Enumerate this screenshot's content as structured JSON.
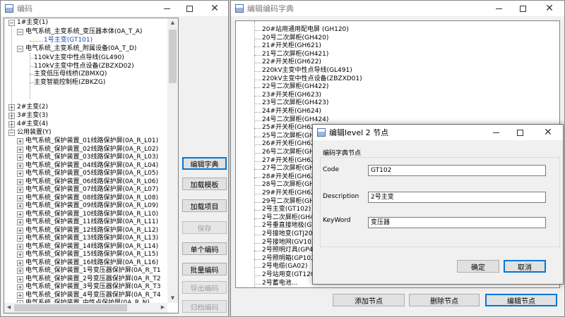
{
  "left_window": {
    "title": "编码",
    "tree": {
      "root1": "1#主变(1)",
      "child1": "电气系统_主变系统_变压器本体(0A_T_A)",
      "leaf1": "1号主变(GT101)",
      "child2": "电气系统_主变系统_附属设备(0A_T_D)",
      "sub_items": [
        "110kV主变中性点导线(GL490)",
        "110kV主变中性点设备(ZBZXD02)",
        "主变低压母线桥(ZBMXQ)",
        "主变智能控制柜(ZBKZG)"
      ],
      "roots": [
        "2#主变(2)",
        "3#主变(3)",
        "4#主变(4)"
      ],
      "public": "公用装置(Y)",
      "public_items": [
        "电气系统_保护装置_01线路保护屏(0A_R_L01)",
        "电气系统_保护装置_02线路保护屏(0A_R_L02)",
        "电气系统_保护装置_03线路保护屏(0A_R_L03)",
        "电气系统_保护装置_04线路保护屏(0A_R_L04)",
        "电气系统_保护装置_05线路保护屏(0A_R_L05)",
        "电气系统_保护装置_06线路保护屏(0A_R_L06)",
        "电气系统_保护装置_07线路保护屏(0A_R_L07)",
        "电气系统_保护装置_08线路保护屏(0A_R_L08)",
        "电气系统_保护装置_09线路保护屏(0A_R_L09)",
        "电气系统_保护装置_10线路保护屏(0A_R_L10)",
        "电气系统_保护装置_11线路保护屏(0A_R_L11)",
        "电气系统_保护装置_12线路保护屏(0A_R_L12)",
        "电气系统_保护装置_13线路保护屏(0A_R_L13)",
        "电气系统_保护装置_14线路保护屏(0A_R_L14)",
        "电气系统_保护装置_15线路保护屏(0A_R_L15)",
        "电气系统_保护装置_16线路保护屏(0A_R_L16)",
        "电气系统_保护装置_1号变压器保护屏(0A_R_T1",
        "电气系统_保护装置_2号变压器保护屏(0A_R_T2",
        "电气系统_保护装置_3号变压器保护屏(0A_R_T3",
        "电气系统_保护装置_4号变压器保护屏(0A_R_T4",
        "电气系统_保护装置_中性点保护屏(0A_R_N)",
        "电气系统_保护装置_备用电源自投屏(0A_R_S)"
      ]
    },
    "buttons": {
      "edit_dict": "编辑字典",
      "load_template": "加载模板",
      "load_items": "加载项目",
      "save": "保存",
      "single_code": "单个编码",
      "batch_code": "批量编码",
      "export_code": "导出编码",
      "import_code": "归档编码"
    }
  },
  "right_window": {
    "title": "编辑编码字典",
    "tree_items": [
      "20#站用通用配电屏 (GH120)",
      "20号二次屏柜(GH420)",
      "21#开关柜(GH621)",
      "21号二次屏柜(GH421)",
      "22#开关柜(GH622)",
      "220kV主变中性点导线(GL491)",
      "220kV主变中性点设备(ZBZXD01)",
      "22号二次屏柜(GH422)",
      "23#开关柜(GH623)",
      "23号二次屏柜(GH423)",
      "24#开关柜(GH624)",
      "24号二次屏柜(GH424)",
      "25#开关柜(GH625)",
      "25号二次屏柜(GH4",
      "26#开关柜(GH626)",
      "26号二次屏柜(GH4",
      "27#开关柜(GH627)",
      "27号二次屏柜(GH4",
      "28#开关柜(GH628)",
      "28号二次屏柜(GH4",
      "29#开关柜(GH629)",
      "29号二次屏柜(GH4",
      "2号主变(GT102)",
      "2号二次屏柜(GH40",
      "2号垂直接地极(GV",
      "2号接地变(GTJ20)",
      "2号接地网(GV102)",
      "2号照明灯具(GP40",
      "2号照明箱(GP102)",
      "2号电缆(GA02)",
      "2号站用变(GT120)",
      "2号蓄电池..."
    ],
    "buttons": {
      "add_node": "添加节点",
      "delete_node": "删除节点",
      "edit_node": "编辑节点"
    }
  },
  "dialog": {
    "title": "编辑level 2 节点",
    "group_label": "编码字典节点",
    "code_label": "Code",
    "code_value": "GT102",
    "description_label": "Description",
    "description_value": "2号主变",
    "keyword_label": "KeyWord",
    "keyword_value": "变压器",
    "ok": "确定",
    "cancel": "取消"
  }
}
